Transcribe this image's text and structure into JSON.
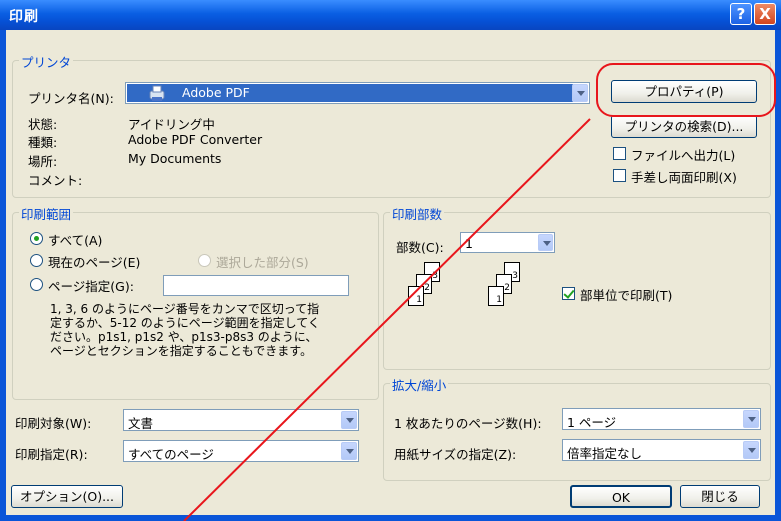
{
  "dialog": {
    "title": "印刷",
    "help_label": "?",
    "close_label": "X"
  },
  "printer": {
    "group_label": "プリンタ",
    "name_label": "プリンタ名(N):",
    "name_value": "Adobe PDF",
    "status_label": "状態:",
    "status_value": "アイドリング中",
    "type_label": "種類:",
    "type_value": "Adobe PDF Converter",
    "location_label": "場所:",
    "location_value": "My Documents",
    "comment_label": "コメント:",
    "properties_button": "プロパティ(P)",
    "find_printer_button": "プリンタの検索(D)...",
    "print_to_file_label": "ファイルへ出力(L)",
    "print_to_file_checked": false,
    "manual_duplex_label": "手差し両面印刷(X)",
    "manual_duplex_checked": false
  },
  "range": {
    "group_label": "印刷範囲",
    "all_label": "すべて(A)",
    "current_label": "現在のページ(E)",
    "selection_label": "選択した部分(S)",
    "pages_label": "ページ指定(G):",
    "pages_value": "",
    "selected_option": "all",
    "help_line1": "1, 3, 6 のようにページ番号をカンマで区切って指",
    "help_line2": "定するか、5-12 のようにページ範囲を指定してく",
    "help_line3": "ださい。p1s1, p1s2 や、p1s3-p8s3 のように、",
    "help_line4": "ページとセクションを指定することもできます。"
  },
  "copies": {
    "group_label": "印刷部数",
    "count_label": "部数(C):",
    "count_value": "1",
    "collate_label": "部単位で印刷(T)",
    "collate_checked": true,
    "page_labels": [
      "1",
      "2",
      "3"
    ]
  },
  "print_what": {
    "label": "印刷対象(W):",
    "value": "文書"
  },
  "print_range": {
    "label": "印刷指定(R):",
    "value": "すべてのページ"
  },
  "zoom": {
    "group_label": "拡大/縮小",
    "pages_per_sheet_label": "1 枚あたりのページ数(H):",
    "pages_per_sheet_value": "1 ページ",
    "paper_size_label": "用紙サイズの指定(Z):",
    "paper_size_value": "倍率指定なし"
  },
  "footer": {
    "options_button": "オプション(O)...",
    "ok_button": "OK",
    "cancel_button": "閉じる"
  },
  "annotation": {
    "highlight_color": "#e8161c",
    "arrow_color": "#e8161c"
  }
}
